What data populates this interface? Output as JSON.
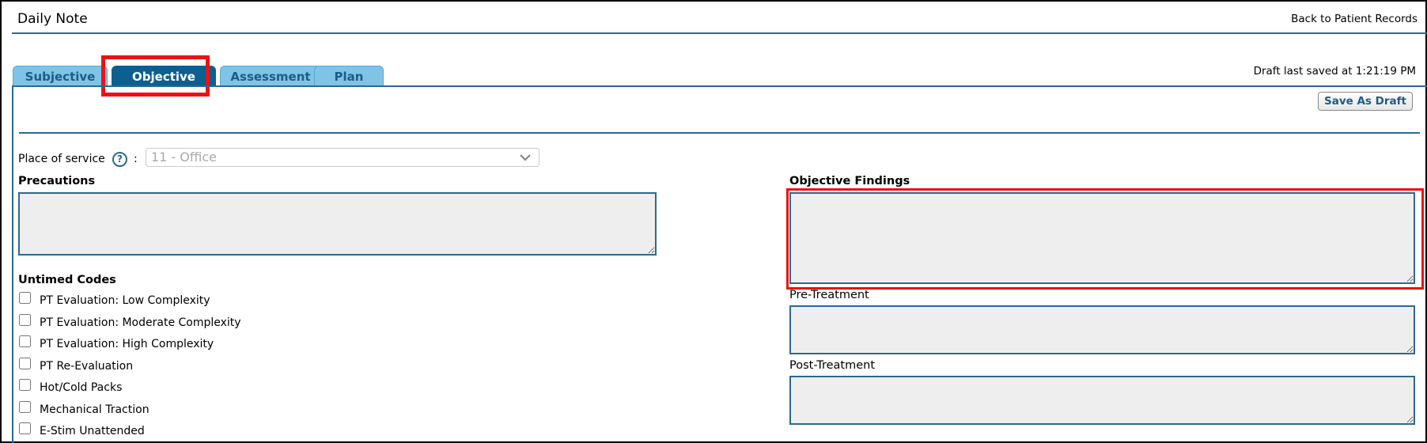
{
  "header": {
    "title": "Daily Note",
    "back_link": "Back to Patient Records"
  },
  "tabs": [
    {
      "label": "Subjective",
      "active": false
    },
    {
      "label": "Objective",
      "active": true
    },
    {
      "label": "Assessment",
      "active": false
    },
    {
      "label": "Plan",
      "active": false
    }
  ],
  "status": {
    "draft_saved": "Draft last saved at 1:21:19 PM"
  },
  "toolbar": {
    "save_draft_label": "Save As Draft"
  },
  "place_of_service": {
    "label": "Place of service",
    "help_icon": "?",
    "colon": ":",
    "selected": "11 - Office"
  },
  "precautions": {
    "label": "Precautions",
    "value": ""
  },
  "untimed_codes": {
    "label": "Untimed Codes",
    "items": [
      {
        "label": "PT Evaluation: Low Complexity",
        "checked": false
      },
      {
        "label": "PT Evaluation: Moderate Complexity",
        "checked": false
      },
      {
        "label": "PT Evaluation: High Complexity",
        "checked": false
      },
      {
        "label": "PT Re-Evaluation",
        "checked": false
      },
      {
        "label": "Hot/Cold Packs",
        "checked": false
      },
      {
        "label": "Mechanical Traction",
        "checked": false
      },
      {
        "label": "E-Stim Unattended",
        "checked": false
      }
    ]
  },
  "objective_findings": {
    "label": "Objective Findings",
    "value": ""
  },
  "pre_treatment": {
    "label": "Pre-Treatment",
    "value": ""
  },
  "post_treatment": {
    "label": "Post-Treatment",
    "value": ""
  },
  "colors": {
    "accent": "#2b6a8e",
    "tab_active": "#0d5f8f",
    "tab_inactive": "#7fc3e6",
    "highlight": "#ee1111",
    "field_bg": "#eeeeee"
  },
  "icons": {
    "help": "help-icon",
    "dropdown": "chevron-down-icon"
  }
}
